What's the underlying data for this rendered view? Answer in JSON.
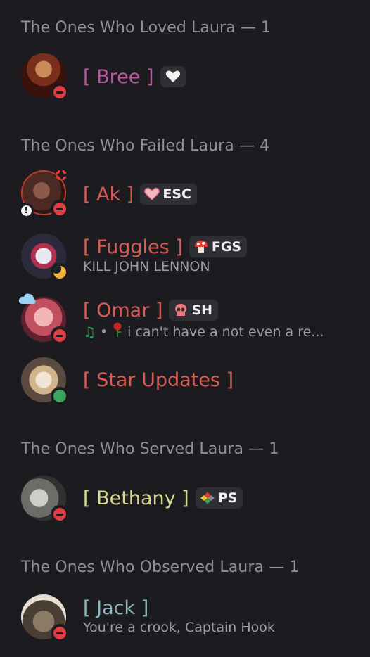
{
  "sections": [
    {
      "header": "The Ones Who Loved Laura — 1"
    },
    {
      "header": "The Ones Who Failed Laura — 4"
    },
    {
      "header": "The Ones Who Served Laura — 1"
    },
    {
      "header": "The Ones Who Observed Laura — 1"
    }
  ],
  "members": {
    "bree": {
      "name": "[ Bree ]",
      "status": "dnd",
      "tag_icon": "white-heart-icon",
      "color": "#b55b9d"
    },
    "ak": {
      "name": "[ Ak ]",
      "status": "dnd",
      "tag": "ESC",
      "tag_icon": "heart-icon",
      "color": "#d95b55"
    },
    "fuggles": {
      "name": "[ Fuggles ]",
      "status": "idle",
      "tag": "FGS",
      "tag_icon": "mushroom-icon",
      "activity": "KILL JOHN LENNON",
      "color": "#d95b55"
    },
    "omar": {
      "name": "[ Omar ]",
      "status": "dnd",
      "tag": "SH",
      "tag_icon": "skull-icon",
      "activity": "i can't have a not even a re...",
      "activity_sep": "•",
      "color": "#d95b55"
    },
    "star": {
      "name": "[ Star Updates ]",
      "status": "online",
      "color": "#d95b55"
    },
    "bethany": {
      "name": "[ Bethany ]",
      "status": "dnd",
      "tag": "PS",
      "tag_icon": "diamond-icon",
      "color": "#d9d990"
    },
    "jack": {
      "name": "[ Jack ]",
      "status": "dnd",
      "activity": "You're a crook, Captain Hook",
      "color": "#8bb6bd"
    }
  }
}
